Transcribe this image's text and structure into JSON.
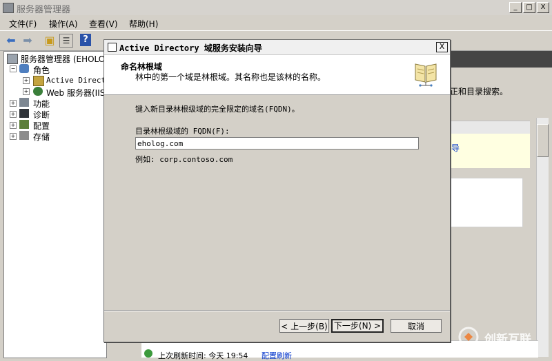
{
  "window": {
    "title": "服务器管理器",
    "min_label": "_",
    "max_label": "□",
    "close_label": "X"
  },
  "menubar": {
    "items": [
      "文件(F)",
      "操作(A)",
      "查看(V)",
      "帮助(H)"
    ]
  },
  "toolbar": {
    "back_icon": "back-arrow-icon",
    "forward_icon": "forward-arrow-icon",
    "up_icon": "up-folder-icon",
    "tree_icon": "show-tree-icon",
    "help_label": "?"
  },
  "tree": {
    "root": "服务器管理器 (EHOLOG",
    "roles": "角色",
    "ad": "Active Directo",
    "web": "Web 服务器(IIS",
    "features": "功能",
    "diagnostics": "诊断",
    "config": "配置",
    "storage": "存储"
  },
  "right": {
    "partial_text": "正和目录搜索。",
    "link_partial": "导",
    "bottom_status": "上次刷新时间: 今天 19:54",
    "bottom_link": "配置刷新"
  },
  "dialog": {
    "title": "Active Directory 域服务安装向导",
    "close_label": "X",
    "heading": "命名林根域",
    "subheading": "林中的第一个域是林根域。其名称也是该林的名称。",
    "instruction": "键入新目录林根级域的完全限定的域名(FQDN)。",
    "field_label": "目录林根级域的 FQDN(F):",
    "field_value": "eholog.com",
    "example": "例如: corp.contoso.com",
    "back_button": "< 上一步(B)",
    "next_button": "下一步(N) >",
    "cancel_button": "取消"
  },
  "watermark": {
    "text": "创新互联"
  },
  "colors": {
    "dialog_bg": "#d4d0c8",
    "link": "#0033cc",
    "tooltip_yellow": "#ffffe1"
  }
}
